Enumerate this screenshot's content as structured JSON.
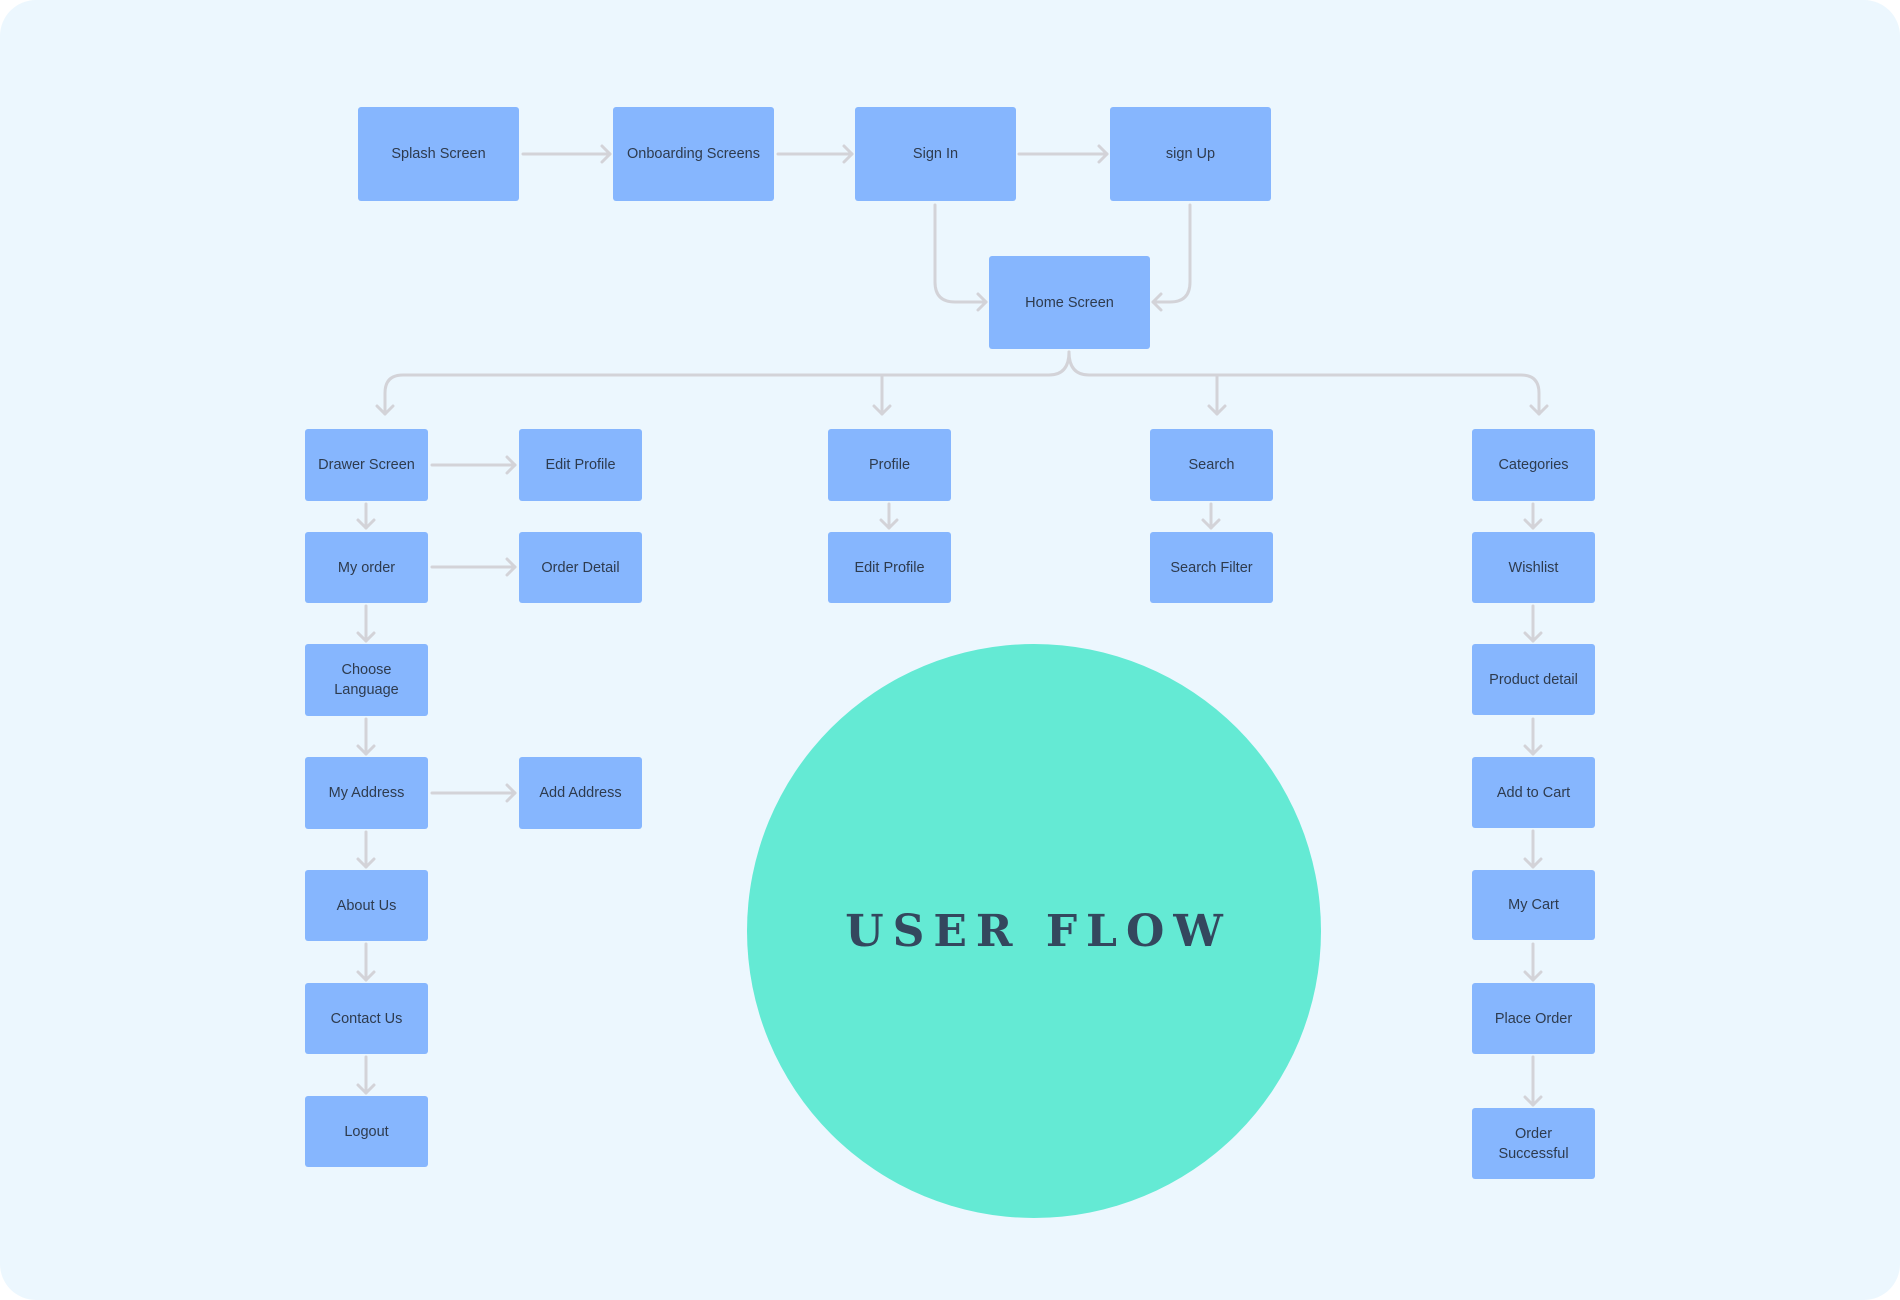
{
  "diagram": {
    "title": "USER FLOW",
    "colors": {
      "background": "#ECF7FE",
      "node_fill": "#86B6FE",
      "node_text": "#2E3B4E",
      "edge": "#D3D3D8",
      "title_circle": "#64EAD4",
      "title_text": "#34475E"
    },
    "nodes": {
      "splash": "Splash Screen",
      "onboarding": "Onboarding Screens",
      "signin": "Sign In",
      "signup": "sign Up",
      "home": "Home Screen",
      "drawer": "Drawer Screen",
      "drawer_edit_profile": "Edit Profile",
      "my_order": "My order",
      "order_detail": "Order Detail",
      "choose_language": "Choose\nLanguage",
      "my_address": "My Address",
      "add_address": "Add Address",
      "about_us": "About Us",
      "contact_us": "Contact Us",
      "logout": "Logout",
      "profile": "Profile",
      "profile_edit_profile": "Edit Profile",
      "search": "Search",
      "search_filter": "Search Filter",
      "categories": "Categories",
      "wishlist": "Wishlist",
      "product_detail": "Product detail",
      "add_to_cart": "Add to Cart",
      "my_cart": "My Cart",
      "place_order": "Place Order",
      "order_successful": "Order\nSuccessful"
    },
    "edges": [
      [
        "splash",
        "onboarding"
      ],
      [
        "onboarding",
        "signin"
      ],
      [
        "signin",
        "signup"
      ],
      [
        "signin",
        "home"
      ],
      [
        "signup",
        "home"
      ],
      [
        "home",
        "drawer"
      ],
      [
        "home",
        "profile"
      ],
      [
        "home",
        "search"
      ],
      [
        "home",
        "categories"
      ],
      [
        "drawer",
        "drawer_edit_profile"
      ],
      [
        "drawer",
        "my_order"
      ],
      [
        "my_order",
        "order_detail"
      ],
      [
        "my_order",
        "choose_language"
      ],
      [
        "choose_language",
        "my_address"
      ],
      [
        "my_address",
        "add_address"
      ],
      [
        "my_address",
        "about_us"
      ],
      [
        "about_us",
        "contact_us"
      ],
      [
        "contact_us",
        "logout"
      ],
      [
        "profile",
        "profile_edit_profile"
      ],
      [
        "search",
        "search_filter"
      ],
      [
        "categories",
        "wishlist"
      ],
      [
        "wishlist",
        "product_detail"
      ],
      [
        "product_detail",
        "add_to_cart"
      ],
      [
        "add_to_cart",
        "my_cart"
      ],
      [
        "my_cart",
        "place_order"
      ],
      [
        "place_order",
        "order_successful"
      ]
    ]
  }
}
